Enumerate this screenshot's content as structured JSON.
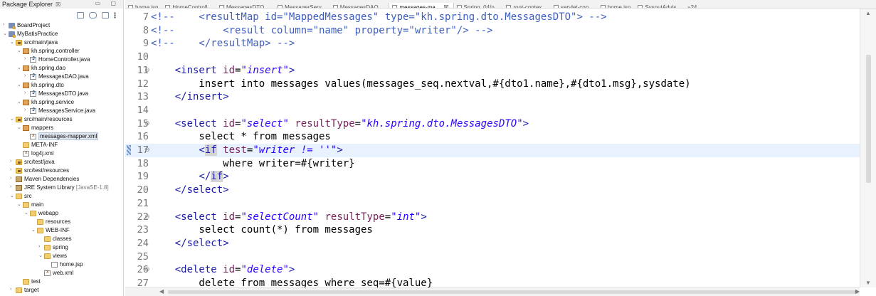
{
  "explorer": {
    "title": "Package Explorer",
    "close_glyph": "☒",
    "window_controls": "▭ ▢",
    "items": [
      {
        "label": "BoardProject",
        "decoration": "",
        "depth": 0,
        "chevron": "›",
        "icon": "project"
      },
      {
        "label": "MyBatisPractice",
        "decoration": "",
        "depth": 0,
        "chevron": "⌄",
        "icon": "project"
      },
      {
        "label": "src/main/java",
        "decoration": "",
        "depth": 1,
        "chevron": "⌄",
        "icon": "srcfolder"
      },
      {
        "label": "kh.spring.controller",
        "decoration": "",
        "depth": 2,
        "chevron": "⌄",
        "icon": "package"
      },
      {
        "label": "HomeController.java",
        "decoration": "",
        "depth": 3,
        "chevron": "›",
        "icon": "java"
      },
      {
        "label": "kh.spring.dao",
        "decoration": "",
        "depth": 2,
        "chevron": "⌄",
        "icon": "package"
      },
      {
        "label": "MessagesDAO.java",
        "decoration": "",
        "depth": 3,
        "chevron": "›",
        "icon": "java"
      },
      {
        "label": "kh.spring.dto",
        "decoration": "",
        "depth": 2,
        "chevron": "⌄",
        "icon": "package"
      },
      {
        "label": "MessagesDTO.java",
        "decoration": "",
        "depth": 3,
        "chevron": "›",
        "icon": "java"
      },
      {
        "label": "kh.spring.service",
        "decoration": "",
        "depth": 2,
        "chevron": "⌄",
        "icon": "package"
      },
      {
        "label": "MessagesService.java",
        "decoration": "",
        "depth": 3,
        "chevron": "›",
        "icon": "java"
      },
      {
        "label": "src/main/resources",
        "decoration": "",
        "depth": 1,
        "chevron": "⌄",
        "icon": "srcfolder"
      },
      {
        "label": "mappers",
        "decoration": "",
        "depth": 2,
        "chevron": "⌄",
        "icon": "package"
      },
      {
        "label": "messages-mapper.xml",
        "decoration": "",
        "depth": 3,
        "chevron": "",
        "icon": "xml",
        "selected": true
      },
      {
        "label": "META-INF",
        "decoration": "",
        "depth": 2,
        "chevron": "",
        "icon": "folder"
      },
      {
        "label": "log4j.xml",
        "decoration": "",
        "depth": 2,
        "chevron": "",
        "icon": "xml"
      },
      {
        "label": "src/test/java",
        "decoration": "",
        "depth": 1,
        "chevron": "›",
        "icon": "srcfolder"
      },
      {
        "label": "src/test/resources",
        "decoration": "",
        "depth": 1,
        "chevron": "›",
        "icon": "srcfolder"
      },
      {
        "label": "Maven Dependencies",
        "decoration": "",
        "depth": 1,
        "chevron": "›",
        "icon": "lib"
      },
      {
        "label": "JRE System Library",
        "decoration": " [JavaSE-1.8]",
        "depth": 1,
        "chevron": "›",
        "icon": "lib"
      },
      {
        "label": "src",
        "decoration": "",
        "depth": 1,
        "chevron": "⌄",
        "icon": "folder"
      },
      {
        "label": "main",
        "decoration": "",
        "depth": 2,
        "chevron": "⌄",
        "icon": "folder"
      },
      {
        "label": "webapp",
        "decoration": "",
        "depth": 3,
        "chevron": "⌄",
        "icon": "folder"
      },
      {
        "label": "resources",
        "decoration": "",
        "depth": 4,
        "chevron": "",
        "icon": "folder"
      },
      {
        "label": "WEB-INF",
        "decoration": "",
        "depth": 4,
        "chevron": "⌄",
        "icon": "folder"
      },
      {
        "label": "classes",
        "decoration": "",
        "depth": 5,
        "chevron": "",
        "icon": "folder"
      },
      {
        "label": "spring",
        "decoration": "",
        "depth": 5,
        "chevron": "›",
        "icon": "folder"
      },
      {
        "label": "views",
        "decoration": "",
        "depth": 5,
        "chevron": "⌄",
        "icon": "folder"
      },
      {
        "label": "home.jsp",
        "decoration": "",
        "depth": 6,
        "chevron": "",
        "icon": "jsp"
      },
      {
        "label": "web.xml",
        "decoration": "",
        "depth": 5,
        "chevron": "",
        "icon": "xml"
      },
      {
        "label": "test",
        "decoration": "",
        "depth": 2,
        "chevron": "",
        "icon": "folder"
      },
      {
        "label": "target",
        "decoration": "",
        "depth": 1,
        "chevron": "›",
        "icon": "folder"
      }
    ]
  },
  "tabs": [
    {
      "label": "home.jsp"
    },
    {
      "label": "HomeControll..."
    },
    {
      "label": "MessagesDTO...."
    },
    {
      "label": "MessagerServ..."
    },
    {
      "label": "MessagesDAO...."
    },
    {
      "label": "messages-ma...",
      "active": true
    },
    {
      "label": "Spring_04/p..."
    },
    {
      "label": "root-contex..."
    },
    {
      "label": "servlet-con..."
    },
    {
      "label": "home.jsp"
    },
    {
      "label": "SysoutAdvis..."
    }
  ],
  "tab_overflow": "»24",
  "tab_close_glyph": "☒",
  "editor": {
    "current_line": 17,
    "lines": [
      {
        "n": "7",
        "fold": "",
        "html": "<span class=\"com\">&lt;!--    &lt;resultMap id=\"MappedMessages\" type=\"kh.spring.dto.MessagesDTO\"&gt; --&gt;</span>"
      },
      {
        "n": "8",
        "fold": "",
        "html": "<span class=\"com\">&lt;!--        &lt;result column=\"name\" property=\"writer\"/&gt; --&gt;</span>"
      },
      {
        "n": "9",
        "fold": "",
        "html": "<span class=\"com\">&lt;!--    &lt;/resultMap&gt; --&gt;</span>"
      },
      {
        "n": "10",
        "fold": "",
        "html": ""
      },
      {
        "n": "11",
        "fold": "⊖",
        "html": "    <span class=\"tag\">&lt;insert</span> <span class=\"attr\">id</span>=<span class=\"val\">\"insert\"</span><span class=\"tag\">&gt;</span>"
      },
      {
        "n": "12",
        "fold": "",
        "html": "        insert into messages values(messages_seq.nextval,#{dto1.name},#{dto1.msg},sysdate)"
      },
      {
        "n": "13",
        "fold": "",
        "html": "    <span class=\"tag\">&lt;/insert&gt;</span>"
      },
      {
        "n": "14",
        "fold": "",
        "html": ""
      },
      {
        "n": "15",
        "fold": "⊖",
        "html": "    <span class=\"tag\">&lt;select</span> <span class=\"attr\">id</span>=<span class=\"val\">\"select\"</span> <span class=\"attr\">resultType</span>=<span class=\"val\">\"kh.spring.dto.MessagesDTO\"</span><span class=\"tag\">&gt;</span>"
      },
      {
        "n": "16",
        "fold": "",
        "html": "        select * from messages"
      },
      {
        "n": "17",
        "fold": "⊖",
        "html": "        <span class=\"tag\">&lt;<span class=\"hl\">if</span></span> <span class=\"attr\">test</span>=<span class=\"val\">\"writer != ''\"</span><span class=\"tag\">&gt;</span>"
      },
      {
        "n": "18",
        "fold": "",
        "html": "            where writer=#{writer}"
      },
      {
        "n": "19",
        "fold": "",
        "html": "        <span class=\"tag\">&lt;/<span class=\"hl\">if</span>&gt;</span>"
      },
      {
        "n": "20",
        "fold": "",
        "html": "    <span class=\"tag\">&lt;/select&gt;</span>"
      },
      {
        "n": "21",
        "fold": "",
        "html": ""
      },
      {
        "n": "22",
        "fold": "⊖",
        "html": "    <span class=\"tag\">&lt;select</span> <span class=\"attr\">id</span>=<span class=\"val\">\"selectCount\"</span> <span class=\"attr\">resultType</span>=<span class=\"val\">\"int\"</span><span class=\"tag\">&gt;</span>"
      },
      {
        "n": "23",
        "fold": "",
        "html": "        select count(*) from messages"
      },
      {
        "n": "24",
        "fold": "",
        "html": "    <span class=\"tag\">&lt;/select&gt;</span>"
      },
      {
        "n": "25",
        "fold": "",
        "html": ""
      },
      {
        "n": "26",
        "fold": "⊖",
        "html": "    <span class=\"tag\">&lt;delete</span> <span class=\"attr\">id</span>=<span class=\"val\">\"delete\"</span><span class=\"tag\">&gt;</span>"
      },
      {
        "n": "27",
        "fold": "",
        "html": "        delete from messages where seq=#{value}"
      }
    ]
  },
  "scroll": {
    "up": "▲",
    "down": "▼",
    "left": "◀",
    "right": "▶"
  }
}
